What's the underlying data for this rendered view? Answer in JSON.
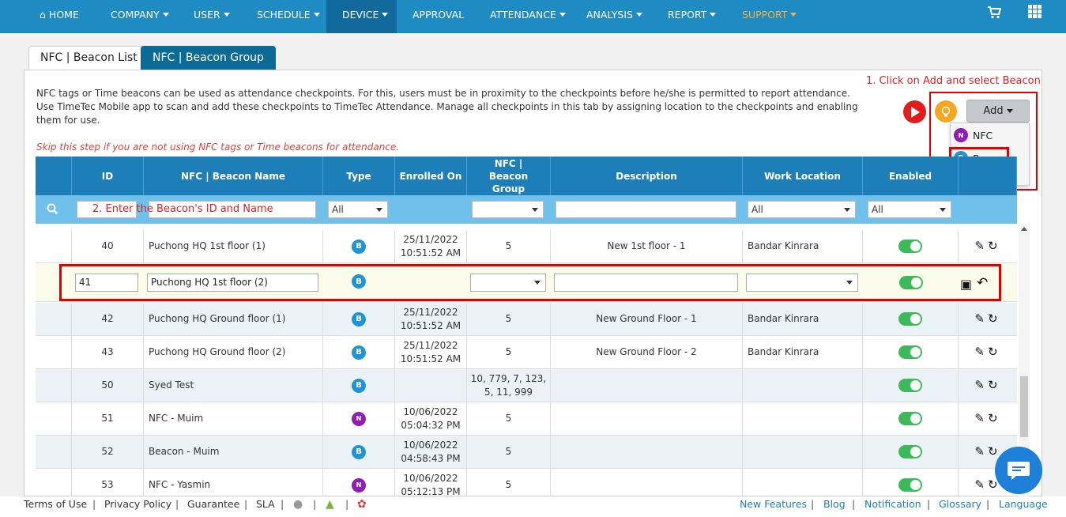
{
  "nav": {
    "home": "HOME",
    "items": [
      "COMPANY",
      "USER",
      "SCHEDULE",
      "DEVICE",
      "APPROVAL",
      "ATTENDANCE",
      "ANALYSIS",
      "REPORT",
      "SUPPORT"
    ],
    "active": "DEVICE",
    "support_color": "#f5b042"
  },
  "tabs": [
    "NFC | Beacon List",
    "NFC | Beacon Group"
  ],
  "intro": "NFC tags or Time beacons can be used as attendance checkpoints. For this, users must be in proximity to the checkpoints before he/she is permitted to report attendance. Use TimeTec Mobile app to scan and add these checkpoints to TimeTec Attendance. Manage all checkpoints in this tab by assigning location to the checkpoints and enabling them for use.",
  "skip_note": "Skip this step if you are not using NFC tags or Time beacons for attendance.",
  "annotations": {
    "step1": "1. Click on Add and select Beacon",
    "step2": "2. Enter the Beacon's ID and Name"
  },
  "add_button": "Add",
  "add_menu": [
    "NFC",
    "Beacon"
  ],
  "columns": [
    "ID",
    "NFC | Beacon Name",
    "Type",
    "Enrolled On",
    "NFC | Beacon Group",
    "Description",
    "Work Location",
    "Enabled"
  ],
  "filters": {
    "type": "All",
    "work_location": "All",
    "enabled": "All"
  },
  "rows": [
    {
      "id": "40",
      "name": "Puchong HQ 1st floor (1)",
      "type": "beacon",
      "enrolled": "25/11/2022 10:51:52 AM",
      "group": "5",
      "description": "New 1st floor - 1",
      "location": "Bandar Kinrara",
      "enabled": true
    },
    {
      "id": "42",
      "name": "Puchong HQ Ground floor (1)",
      "type": "beacon",
      "enrolled": "25/11/2022 10:51:52 AM",
      "group": "5",
      "description": "New Ground Floor - 1",
      "location": "Bandar Kinrara",
      "enabled": true
    },
    {
      "id": "43",
      "name": "Puchong HQ Ground floor (2)",
      "type": "beacon",
      "enrolled": "25/11/2022 10:51:52 AM",
      "group": "5",
      "description": "New Ground Floor - 2",
      "location": "Bandar Kinrara",
      "enabled": true
    },
    {
      "id": "50",
      "name": "Syed Test",
      "type": "beacon",
      "enrolled": "",
      "group": "10, 779, 7, 123, 5, 11, 999",
      "description": "",
      "location": "",
      "enabled": true
    },
    {
      "id": "51",
      "name": "NFC - Muim",
      "type": "nfc",
      "enrolled": "10/06/2022 05:04:32 PM",
      "group": "5",
      "description": "",
      "location": "",
      "enabled": true
    },
    {
      "id": "52",
      "name": "Beacon - Muim",
      "type": "beacon",
      "enrolled": "10/06/2022 04:58:43 PM",
      "group": "5",
      "description": "",
      "location": "",
      "enabled": true
    },
    {
      "id": "53",
      "name": "NFC - Yasmin",
      "type": "nfc",
      "enrolled": "10/06/2022 05:12:13 PM",
      "group": "5",
      "description": "",
      "location": "",
      "enabled": true
    }
  ],
  "edit_row": {
    "id": "41",
    "name": "Puchong HQ 1st floor (2)"
  },
  "footer_left": [
    "Terms of Use",
    "Privacy Policy",
    "Guarantee",
    "SLA"
  ],
  "footer_right": [
    "New Features",
    "Blog",
    "Notification",
    "Glossary",
    "Language"
  ]
}
